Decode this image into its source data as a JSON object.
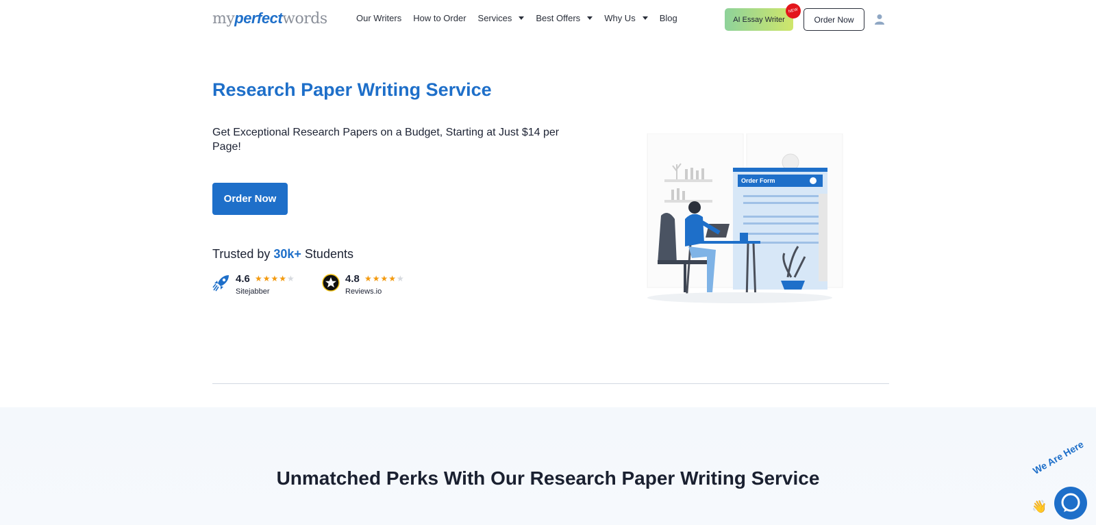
{
  "header": {
    "logo": {
      "my": "my",
      "perfect": "perfect",
      "words": "words"
    },
    "nav": [
      {
        "label": "Our Writers",
        "dropdown": false
      },
      {
        "label": "How to Order",
        "dropdown": false
      },
      {
        "label": "Services",
        "dropdown": true
      },
      {
        "label": "Best Offers",
        "dropdown": true
      },
      {
        "label": "Why Us",
        "dropdown": true
      },
      {
        "label": "Blog",
        "dropdown": false
      }
    ],
    "ai_button": "AI Essay Writer",
    "new_badge": "NEW",
    "order_button": "Order Now",
    "user_icon": "user-icon"
  },
  "hero": {
    "title": "Research Paper Writing Service",
    "subtitle": "Get Exceptional Research Papers on a Budget, Starting at Just $14 per Page!",
    "cta": "Order Now",
    "trusted_prefix": "Trusted by ",
    "trusted_highlight": "30k+",
    "trusted_suffix": " Students",
    "ratings": [
      {
        "score": "4.6",
        "source": "Sitejabber",
        "stars": 4,
        "icon": "rocket-icon"
      },
      {
        "score": "4.8",
        "source": "Reviews.io",
        "stars": 4,
        "icon": "star-badge-icon"
      }
    ],
    "illustration_order_form": "Order Form"
  },
  "perks": {
    "title": "Unmatched Perks With Our Research Paper Writing Service"
  },
  "chat": {
    "label": "We Are Here",
    "icon": "chat-icon"
  },
  "colors": {
    "brand": "#1e6fc9",
    "star": "#f39a0f",
    "badge": "#e3161c"
  }
}
